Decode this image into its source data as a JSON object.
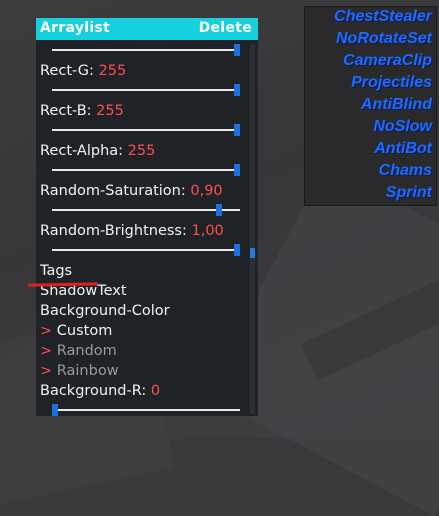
{
  "panel": {
    "title": "Arraylist",
    "delete_label": "Delete",
    "settings": [
      {
        "label": "Rect-G: ",
        "value": "255"
      },
      {
        "label": "Rect-B: ",
        "value": "255"
      },
      {
        "label": "Rect-Alpha: ",
        "value": "255"
      },
      {
        "label": "Random-Saturation: ",
        "value": "0,90"
      },
      {
        "label": "Random-Brightness: ",
        "value": "1,00"
      }
    ],
    "tags_label": "Tags",
    "shadowtext_label": "ShadowText",
    "bgcolor_label": "Background-Color",
    "options": [
      {
        "arrow": ">",
        "label": " Custom"
      },
      {
        "arrow": ">",
        "label": " Random"
      },
      {
        "arrow": ">",
        "label": " Rainbow"
      }
    ],
    "background_r": {
      "label": "Background-R: ",
      "value": "0"
    },
    "slider_fractions": {
      "top": 1.0,
      "rect_g": 1.0,
      "rect_b": 1.0,
      "rect_alpha": 1.0,
      "random_saturation": 0.9,
      "random_brightness": 1.0,
      "background_r": 0.0
    }
  },
  "arraylist": {
    "modules": [
      "ChestStealer",
      "NoRotateSet",
      "CameraClip",
      "Projectiles",
      "AntiBlind",
      "NoSlow",
      "AntiBot",
      "Chams",
      "Sprint"
    ]
  },
  "colors": {
    "header": "#17d0de",
    "value_red": "#ff4d4d",
    "module_blue": "#1e6bff",
    "panel_bg": "#1f2327",
    "knob_blue": "#1e6fe0"
  }
}
